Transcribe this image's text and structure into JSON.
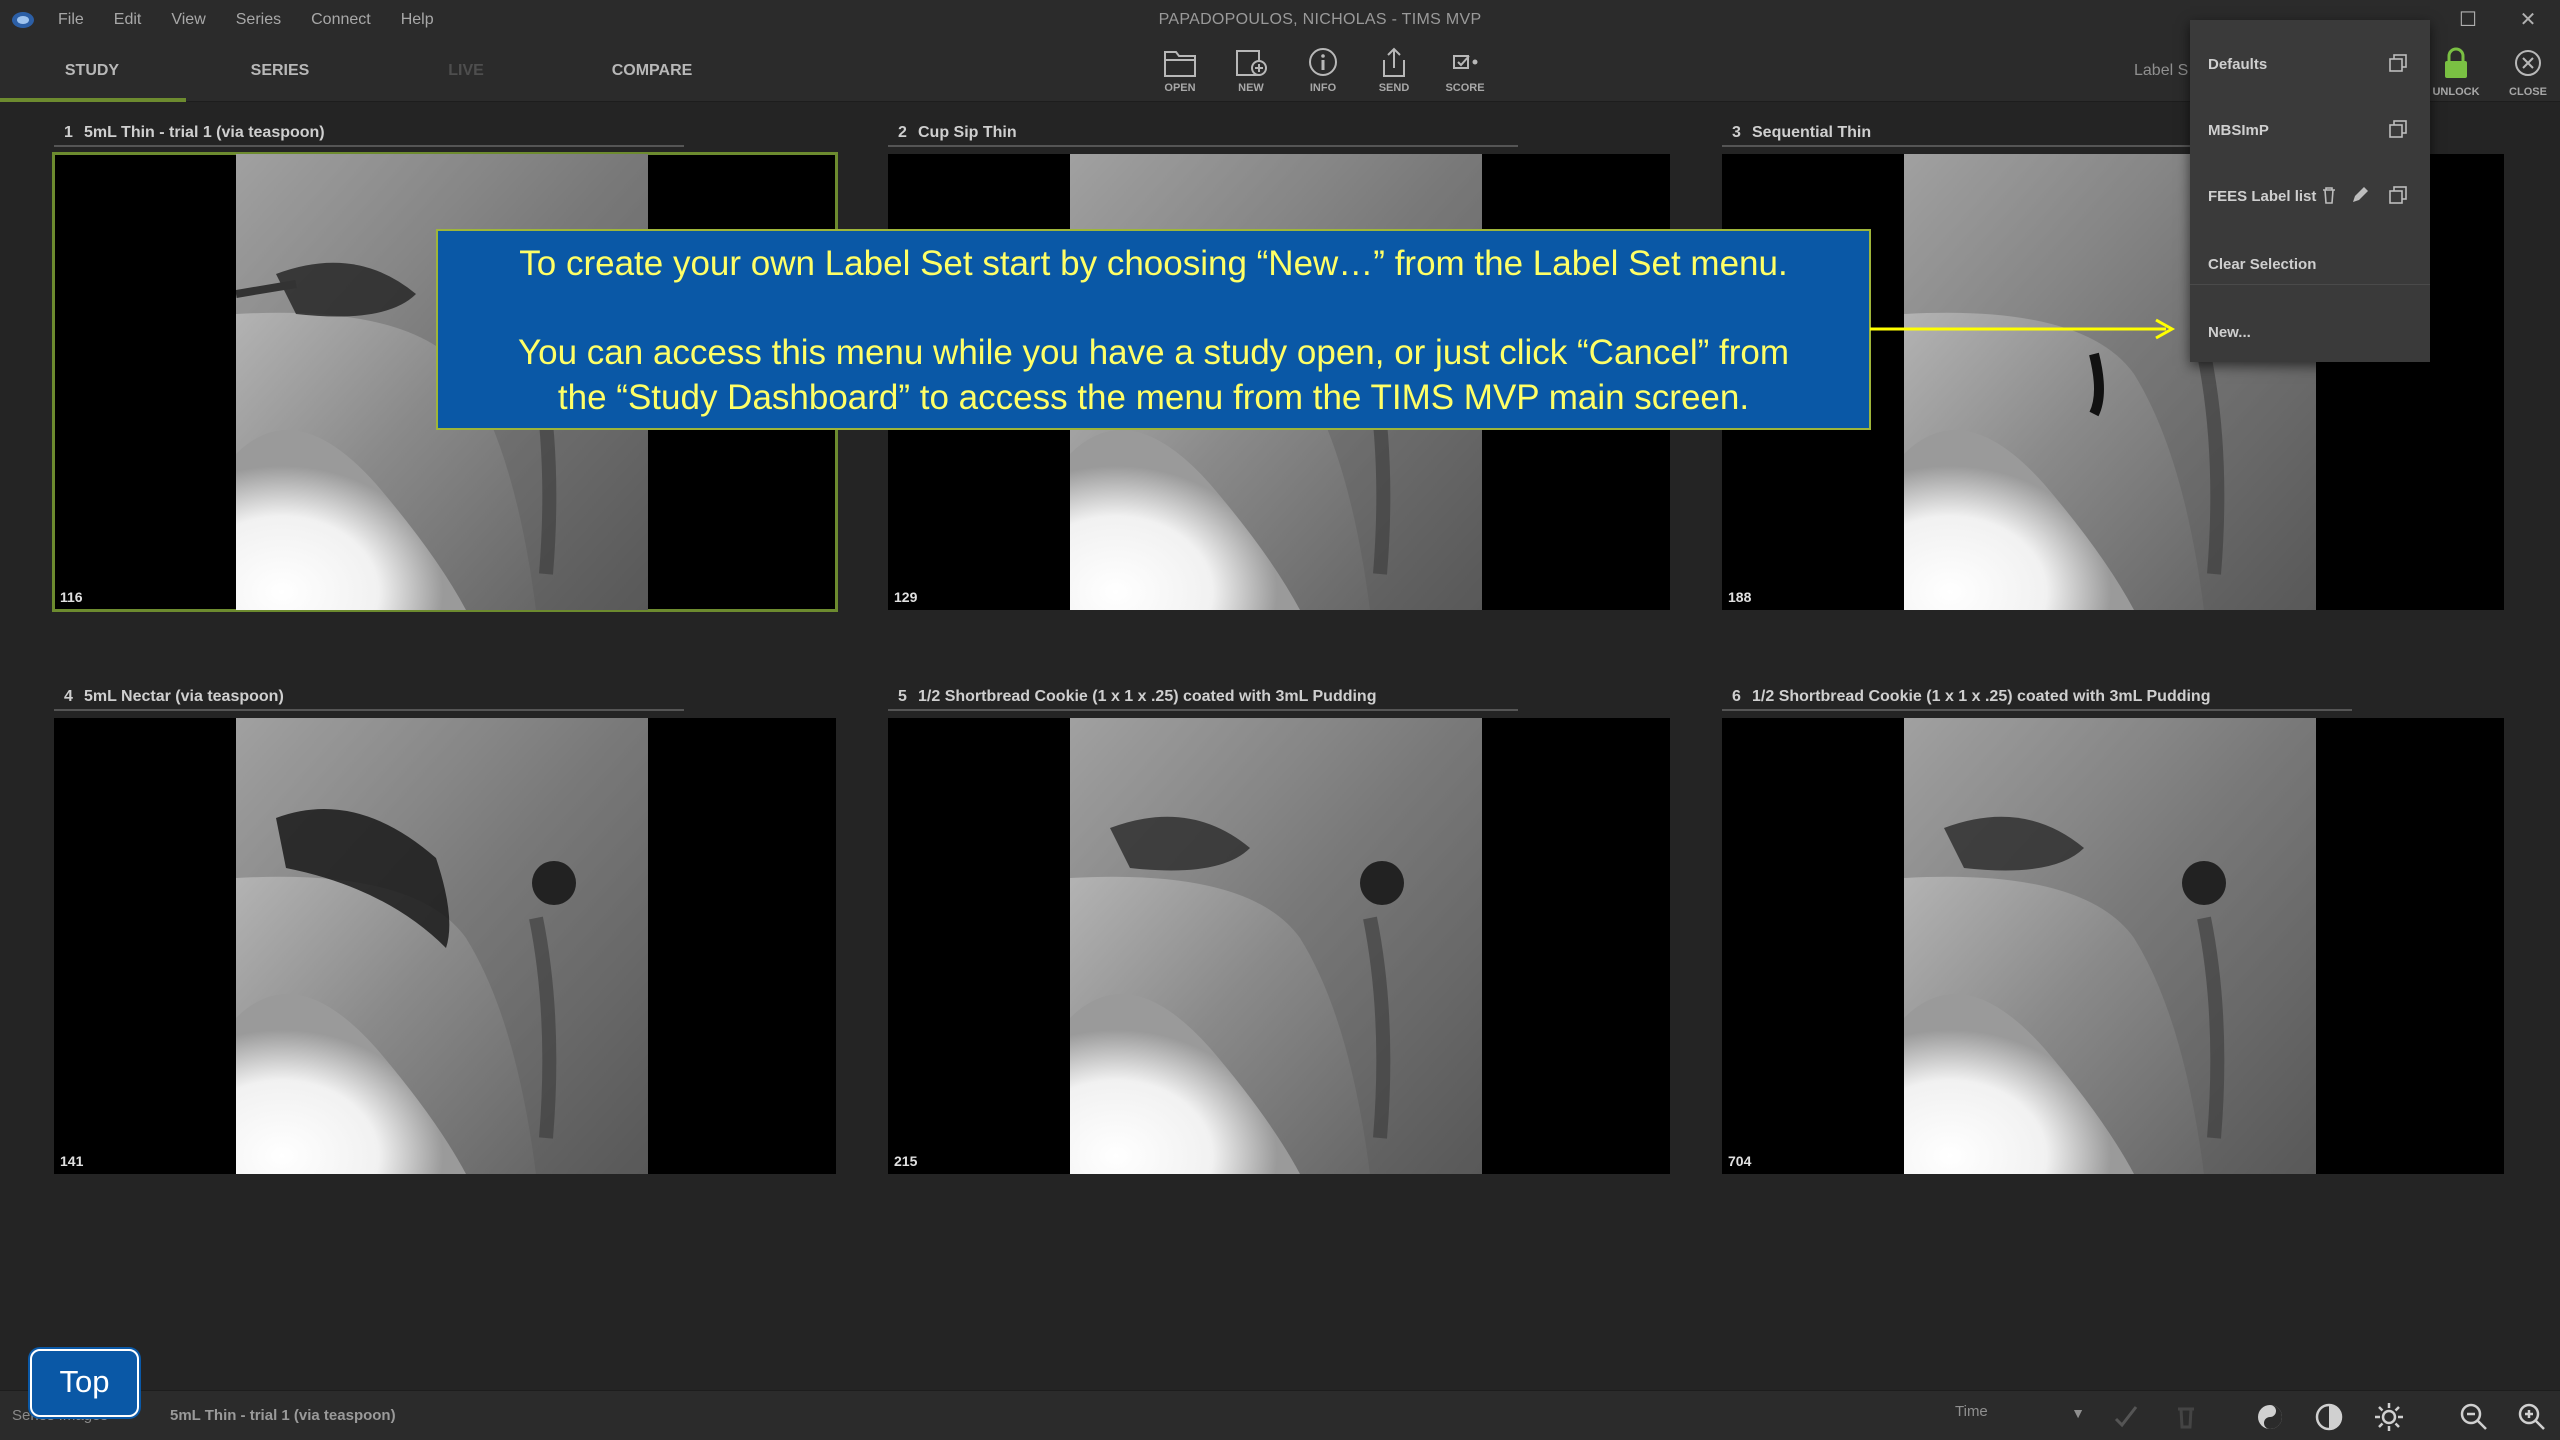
{
  "app": {
    "window_title": "PAPADOPOULOS, NICHOLAS - TIMS MVP",
    "menu": [
      "File",
      "Edit",
      "View",
      "Series",
      "Connect",
      "Help"
    ]
  },
  "toolbar": {
    "tabs": [
      {
        "label": "STUDY",
        "active": true
      },
      {
        "label": "SERIES",
        "active": false
      },
      {
        "label": "LIVE",
        "active": false,
        "disabled": true
      },
      {
        "label": "COMPARE",
        "active": false
      }
    ],
    "tools": [
      {
        "label": "OPEN",
        "icon": "folder-icon"
      },
      {
        "label": "NEW",
        "icon": "new-icon"
      },
      {
        "label": "INFO",
        "icon": "info-icon"
      },
      {
        "label": "SEND",
        "icon": "send-icon"
      },
      {
        "label": "SCORE",
        "icon": "score-icon"
      }
    ],
    "label_set_label": "Label S",
    "unlock_label": "UNLOCK",
    "close_label": "CLOSE"
  },
  "label_set_menu": {
    "items": [
      {
        "label": "Defaults"
      },
      {
        "label": "MBSImP"
      },
      {
        "label": "FEES Label list"
      },
      {
        "label": "Clear Selection"
      },
      {
        "label": "New..."
      }
    ]
  },
  "series": [
    {
      "index": "1",
      "name": "5mL Thin - trial 1 (via teaspoon)",
      "frames": "116",
      "selected": true
    },
    {
      "index": "2",
      "name": "Cup Sip Thin",
      "frames": "129",
      "selected": false
    },
    {
      "index": "3",
      "name": "Sequential Thin",
      "frames": "188",
      "selected": false
    },
    {
      "index": "4",
      "name": "5mL Nectar (via teaspoon)",
      "frames": "141",
      "selected": false
    },
    {
      "index": "5",
      "name": "1/2 Shortbread Cookie (1 x 1 x .25) coated with 3mL Pudding",
      "frames": "215",
      "selected": false
    },
    {
      "index": "6",
      "name": "1/2 Shortbread Cookie (1 x 1 x .25) coated with 3mL Pudding",
      "frames": "704",
      "selected": false
    }
  ],
  "callout": {
    "para1": "To create your own Label Set start by choosing “New…” from the Label Set menu.",
    "para2": "You can access this menu while you have a study open, or just click “Cancel” from\nthe “Study Dashboard” to access the menu from the TIMS MVP main screen."
  },
  "statusbar": {
    "label": "Series Images",
    "current_series": "5mL Thin - trial 1 (via teaspoon)",
    "time_select": "Time"
  },
  "top_button": "Top",
  "colors": {
    "accent_green": "#6d8b2f",
    "callout_blue": "#0a58a6",
    "callout_text": "#ffff66",
    "lock_green": "#7ac043"
  }
}
